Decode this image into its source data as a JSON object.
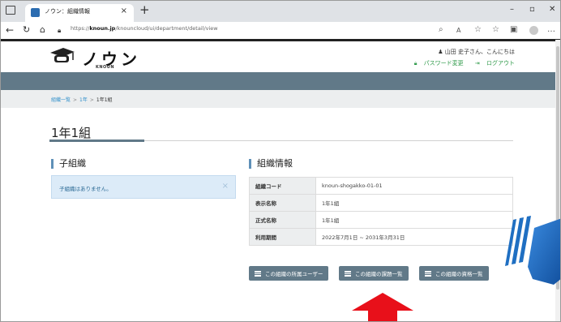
{
  "browser": {
    "tab_title": "ノウン：組織情報",
    "new_tab_icon": "plus-icon",
    "url_prefix": "https://",
    "url_domain": "knoun.jp",
    "url_path": "/knouncloud/ui/department/detail/view"
  },
  "header": {
    "logo_text": "ノウン",
    "logo_sub": "KNOUN",
    "greeting": "山田 史子さん、こんにちは",
    "password_link": "パスワード変更",
    "logout_link": "ログアウト"
  },
  "breadcrumb": {
    "items": [
      "組織一覧",
      "1年",
      "1年1組"
    ]
  },
  "page": {
    "title": "1年1組"
  },
  "child_orgs": {
    "title": "子組織",
    "empty_message": "子組織はありません。"
  },
  "org_info": {
    "title": "組織情報",
    "rows": [
      {
        "key": "組織コード",
        "value": "knoun-shogakko-01-01"
      },
      {
        "key": "表示名称",
        "value": "1年1組"
      },
      {
        "key": "正式名称",
        "value": "1年1組"
      },
      {
        "key": "利用期間",
        "value": "2022年7月1日 ~ 2031年3月31日"
      }
    ]
  },
  "buttons": {
    "users": "この組織の所属ユーザー",
    "tasks": "この組織の課題一覧",
    "qualifications": "この組織の資格一覧"
  },
  "colors": {
    "accent": "#617988",
    "link": "#2f8fca",
    "highlight_arrow": "#e8101a",
    "decoration": "#1f6fc2"
  }
}
